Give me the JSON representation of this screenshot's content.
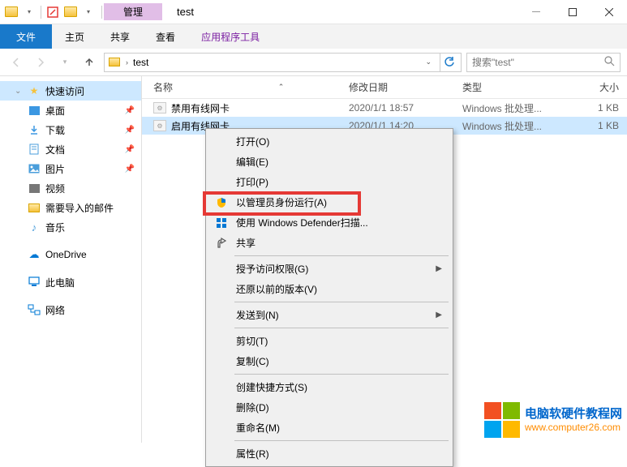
{
  "titlebar": {
    "context_tab": "管理",
    "folder_name": "test"
  },
  "ribbon": {
    "file": "文件",
    "tabs": [
      "主页",
      "共享",
      "查看",
      "应用程序工具"
    ]
  },
  "address": {
    "segments": [
      "test"
    ],
    "search_placeholder": "搜索\"test\""
  },
  "sidebar": [
    {
      "icon": "star",
      "label": "快速访问",
      "sel": true,
      "chev": "down"
    },
    {
      "icon": "desktop",
      "label": "桌面",
      "pin": true
    },
    {
      "icon": "download",
      "label": "下载",
      "pin": true
    },
    {
      "icon": "document",
      "label": "文档",
      "pin": true
    },
    {
      "icon": "picture",
      "label": "图片",
      "pin": true
    },
    {
      "icon": "video",
      "label": "视频"
    },
    {
      "icon": "folder",
      "label": "需要导入的邮件"
    },
    {
      "icon": "music",
      "label": "音乐"
    },
    {
      "spacer": true
    },
    {
      "icon": "cloud",
      "label": "OneDrive"
    },
    {
      "spacer": true
    },
    {
      "icon": "pc",
      "label": "此电脑"
    },
    {
      "spacer": true
    },
    {
      "icon": "network",
      "label": "网络"
    }
  ],
  "columns": {
    "name": "名称",
    "date": "修改日期",
    "type": "类型",
    "size": "大小"
  },
  "files": [
    {
      "name": "禁用有线网卡",
      "date": "2020/1/1 18:57",
      "type": "Windows 批处理...",
      "size": "1 KB",
      "sel": false
    },
    {
      "name": "启用有线网卡",
      "date": "2020/1/1 14:20",
      "type": "Windows 批处理...",
      "size": "1 KB",
      "sel": true
    }
  ],
  "context_menu": [
    {
      "label": "打开(O)"
    },
    {
      "label": "编辑(E)"
    },
    {
      "label": "打印(P)"
    },
    {
      "label": "以管理员身份运行(A)",
      "icon": "shield",
      "highlighted": true
    },
    {
      "label": "使用 Windows Defender扫描...",
      "icon": "defender"
    },
    {
      "label": "共享",
      "icon": "share"
    },
    {
      "sep": true
    },
    {
      "label": "授予访问权限(G)",
      "arrow": true
    },
    {
      "label": "还原以前的版本(V)"
    },
    {
      "sep": true
    },
    {
      "label": "发送到(N)",
      "arrow": true
    },
    {
      "sep": true
    },
    {
      "label": "剪切(T)"
    },
    {
      "label": "复制(C)"
    },
    {
      "sep": true
    },
    {
      "label": "创建快捷方式(S)"
    },
    {
      "label": "删除(D)"
    },
    {
      "label": "重命名(M)"
    },
    {
      "sep": true
    },
    {
      "label": "属性(R)"
    }
  ],
  "watermark": {
    "line1": "电脑软硬件教程网",
    "line2": "www.computer26.com"
  }
}
